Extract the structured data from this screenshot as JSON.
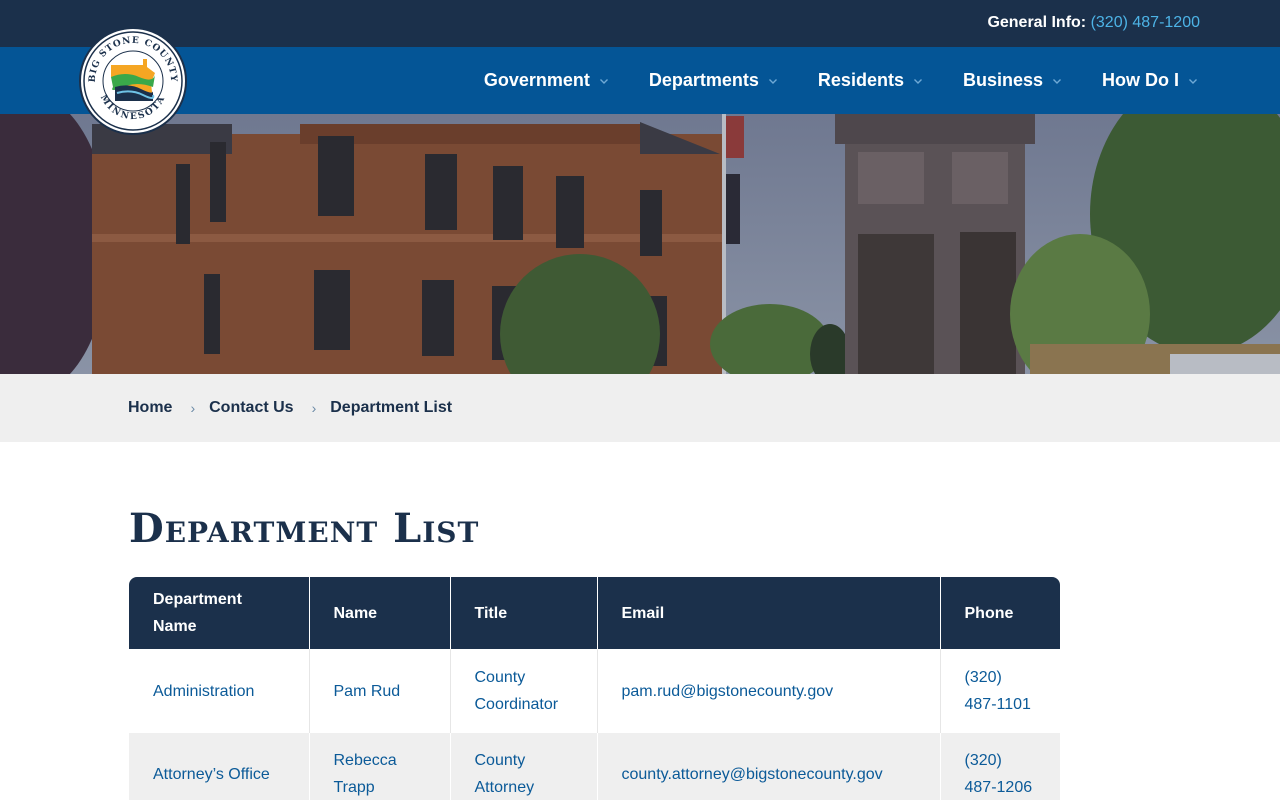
{
  "topbar": {
    "info_label": "General Info:",
    "phone": "(320) 487-1200"
  },
  "logo": {
    "text_top": "BIG STONE COUNTY",
    "text_bottom": "MINNESOTA"
  },
  "nav": {
    "items": [
      {
        "label": "Government"
      },
      {
        "label": "Departments"
      },
      {
        "label": "Residents"
      },
      {
        "label": "Business"
      },
      {
        "label": "How Do I"
      }
    ]
  },
  "breadcrumb": {
    "items": [
      "Home",
      "Contact Us",
      "Department List"
    ]
  },
  "page": {
    "title": "Department List"
  },
  "table": {
    "headers": [
      "Department Name",
      "Name",
      "Title",
      "Email",
      "Phone"
    ],
    "rows": [
      {
        "department": "Administration",
        "name": "Pam Rud",
        "title": "County Coordinator",
        "email": "pam.rud@bigstonecounty.gov",
        "phone": "(320) 487-1101"
      },
      {
        "department": "Attorney’s Office",
        "name": "Rebecca Trapp",
        "title": "County Attorney",
        "email": "county.attorney@bigstonecounty.gov",
        "phone": "(320) 487-1206"
      }
    ]
  },
  "colors": {
    "topbar": "#1b304b",
    "navbar": "#045596",
    "accent_link": "#4db3e6",
    "table_link": "#0b5a98"
  }
}
